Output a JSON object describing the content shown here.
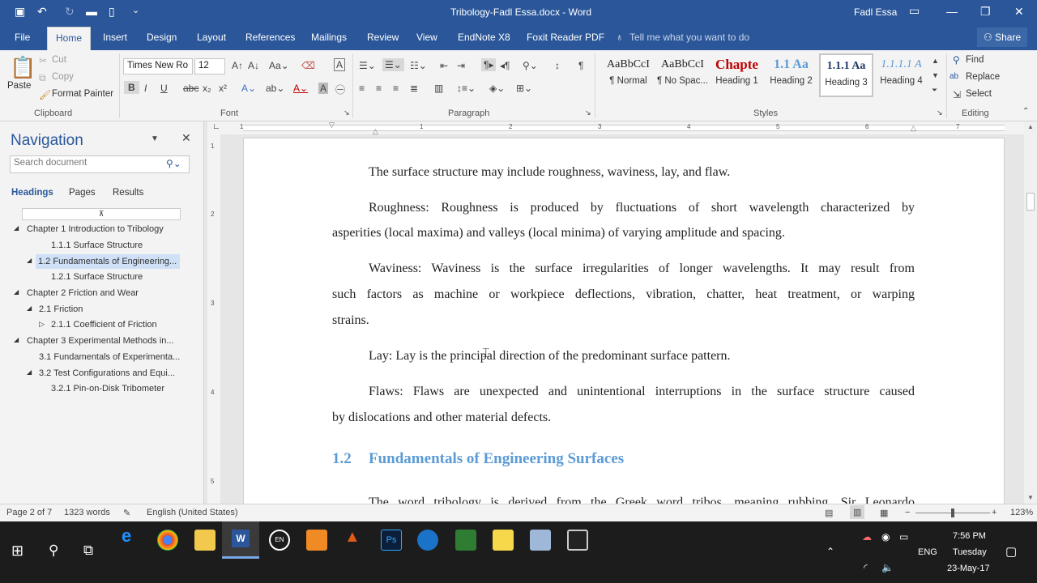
{
  "window": {
    "title": "Tribology-Fadl Essa.docx  -  Word",
    "user": "Fadl Essa"
  },
  "tabs": [
    "File",
    "Home",
    "Insert",
    "Design",
    "Layout",
    "References",
    "Mailings",
    "Review",
    "View",
    "EndNote X8",
    "Foxit Reader PDF"
  ],
  "tell_me": "Tell me what you want to do",
  "share": "Share",
  "clipboard": {
    "paste": "Paste",
    "cut": "Cut",
    "copy": "Copy",
    "format_painter": "Format Painter",
    "group": "Clipboard"
  },
  "font": {
    "name": "Times New Ro",
    "size": "12",
    "group": "Font"
  },
  "paragraph": {
    "group": "Paragraph"
  },
  "styles": {
    "group": "Styles",
    "items": [
      {
        "preview": "AaBbCcI",
        "label": "¶ Normal",
        "color": "#222222"
      },
      {
        "preview": "AaBbCcI",
        "label": "¶ No Spac...",
        "color": "#222222"
      },
      {
        "preview": "Chapte",
        "label": "Heading 1",
        "color": "#c00000"
      },
      {
        "preview": "1.1  Aa",
        "label": "Heading 2",
        "color": "#5b9bd5"
      },
      {
        "preview": "1.1.1  Aa",
        "label": "Heading 3",
        "color": "#1f3864"
      },
      {
        "preview": "1.1.1.1  A",
        "label": "Heading 4",
        "color": "#5b9bd5"
      }
    ]
  },
  "editing": {
    "group": "Editing",
    "find": "Find",
    "replace": "Replace",
    "select": "Select"
  },
  "navigation": {
    "title": "Navigation",
    "search_placeholder": "Search document",
    "tabs": [
      "Headings",
      "Pages",
      "Results"
    ],
    "items": [
      {
        "label": "Chapter 1 Introduction to Tribology",
        "arrow": "◢"
      },
      {
        "label": "1.1.1 Surface Structure",
        "arrow": ""
      },
      {
        "label": "1.2 Fundamentals of Engineering...",
        "arrow": "◢"
      },
      {
        "label": "1.2.1 Surface Structure",
        "arrow": ""
      },
      {
        "label": "Chapter 2 Friction and Wear",
        "arrow": "◢"
      },
      {
        "label": "2.1 Friction",
        "arrow": "◢"
      },
      {
        "label": "2.1.1 Coefficient of Friction",
        "arrow": "▷"
      },
      {
        "label": "Chapter 3 Experimental Methods in...",
        "arrow": "◢"
      },
      {
        "label": "3.1 Fundamentals of Experimenta...",
        "arrow": ""
      },
      {
        "label": "3.2 Test Configurations and Equi...",
        "arrow": "◢"
      },
      {
        "label": "3.2.1 Pin-on-Disk Tribometer",
        "arrow": ""
      }
    ]
  },
  "document": {
    "p1": "The surface structure may include roughness, waviness, lay, and flaw.",
    "p2a": "Roughness: Roughness is produced by fluctuations of short wavelength characterized by",
    "p2b": "asperities (local maxima) and valleys (local minima) of varying amplitude and spacing.",
    "p3a": "Waviness: Waviness is the surface irregularities of longer wavelengths. It may result from",
    "p3b": "such factors as machine or workpiece deflections, vibration, chatter, heat treatment, or warping",
    "p3c": "strains.",
    "p4": "Lay: Lay is the principal direction of the predominant surface pattern.",
    "p5a": "Flaws: Flaws are unexpected and unintentional interruptions in the surface structure caused",
    "p5b": "by dislocations and other material defects.",
    "h_num": "1.2",
    "h_text": "Fundamentals of Engineering Surfaces",
    "p6": "The word tribology is derived from the Greek word tribos, meaning rubbing. Sir Leonardo"
  },
  "status": {
    "page": "Page 2 of 7",
    "words": "1323 words",
    "language": "English (United States)",
    "zoom": "123%"
  },
  "ruler": [
    "1",
    "1",
    "2",
    "3",
    "4",
    "5",
    "6",
    "7"
  ],
  "vruler": [
    "1",
    "2",
    "3",
    "4",
    "5",
    "6"
  ],
  "taskbar": {
    "lang": "ENG",
    "time": "7:56 PM",
    "day": "Tuesday",
    "date": "23-May-17"
  }
}
